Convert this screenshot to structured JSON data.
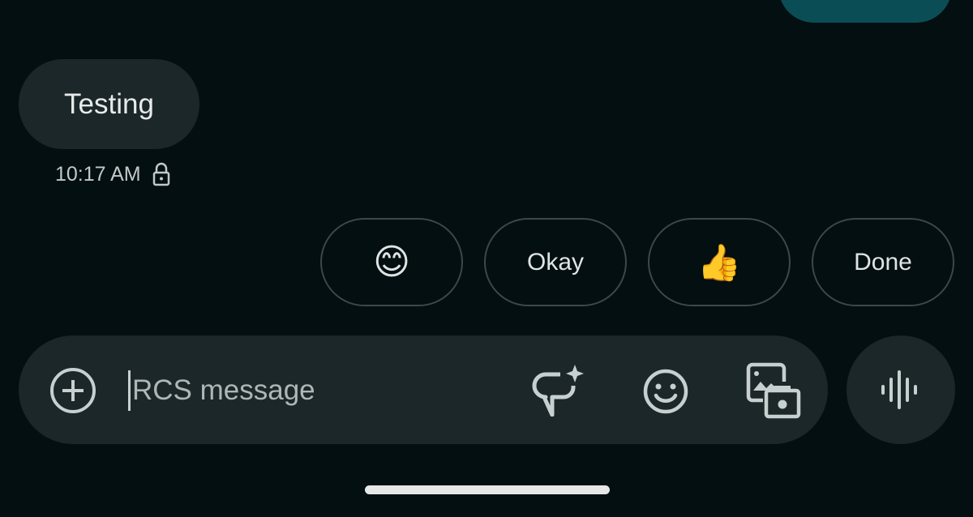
{
  "messages": [
    {
      "direction": "sent",
      "text": ""
    },
    {
      "direction": "received",
      "text": "Testing",
      "time": "10:17 AM",
      "icon": "lock-icon"
    }
  ],
  "suggestions": [
    {
      "label": "😊",
      "type": "emoji"
    },
    {
      "label": "Okay",
      "type": "text"
    },
    {
      "label": "👍",
      "type": "emoji"
    },
    {
      "label": "Done",
      "type": "text"
    }
  ],
  "composer": {
    "placeholder": "RCS message",
    "add_icon": "plus-circle-icon",
    "ai_icon": "sparkle-chat-icon",
    "emoji_icon": "emoji-icon",
    "media_icon": "gallery-camera-icon",
    "voice_icon": "voice-waveform-icon"
  },
  "colors": {
    "background": "#030f11",
    "bubble": "#1c2729",
    "sent_bubble": "#0b4d55",
    "icon": "#c7d0d0"
  }
}
